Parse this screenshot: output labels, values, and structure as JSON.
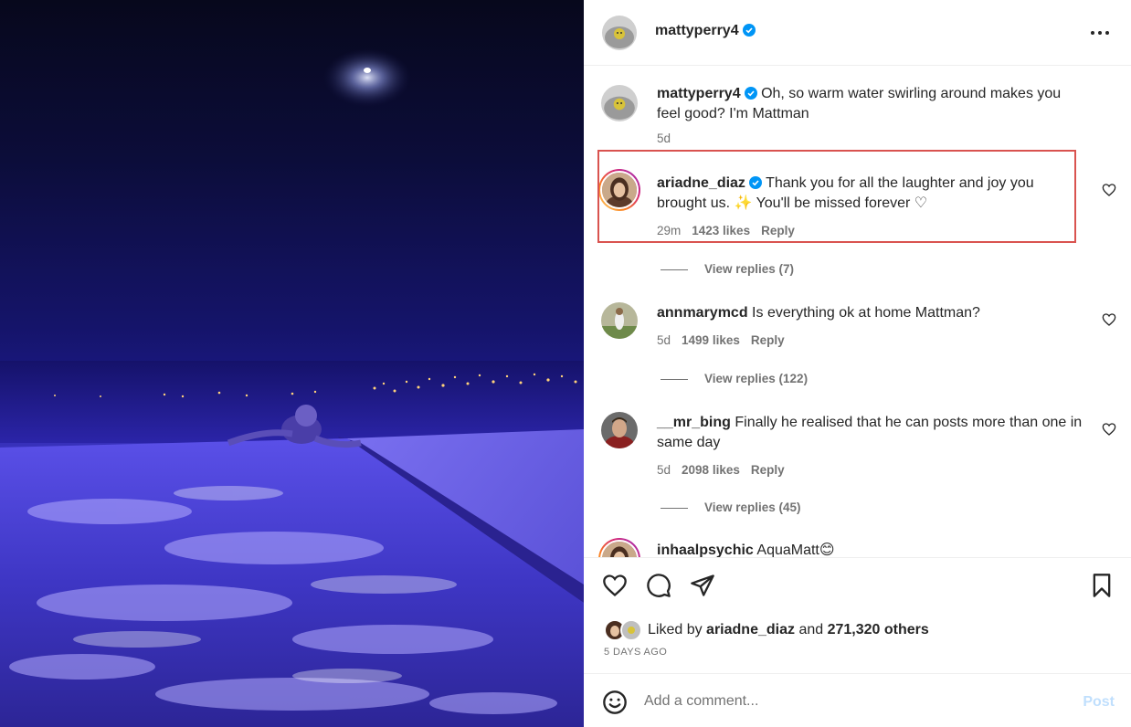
{
  "post": {
    "author": "mattyperry4",
    "image_description_icon": "post-photo"
  },
  "header": {
    "username": "mattyperry4",
    "more_icon": "ellipsis-icon"
  },
  "caption": {
    "username": "mattyperry4",
    "text": "Oh, so warm water swirling around makes you feel good? I'm Mattman",
    "time": "5d"
  },
  "comments": [
    {
      "username": "ariadne_diaz",
      "verified": true,
      "text": "Thank you for all the laughter and joy you brought us. ✨ You'll be missed forever ♡",
      "time": "29m",
      "likes": "1423 likes",
      "reply": "Reply",
      "view_replies": "View replies (7)"
    },
    {
      "username": "annmarymcd",
      "verified": false,
      "text": "Is everything ok at home Mattman?",
      "time": "5d",
      "likes": "1499 likes",
      "reply": "Reply",
      "view_replies": "View replies (122)"
    },
    {
      "username": "__mr_bing",
      "verified": false,
      "text": "Finally he realised that he can posts more than one in same day",
      "time": "5d",
      "likes": "2098 likes",
      "reply": "Reply",
      "view_replies": "View replies (45)"
    },
    {
      "username": "inhaalpsychic",
      "verified": false,
      "text": "AquaMatt😊"
    }
  ],
  "actions": {
    "like_icon": "heart-icon",
    "comment_icon": "comment-icon",
    "share_icon": "share-icon",
    "save_icon": "bookmark-icon",
    "liked_prefix": "Liked by",
    "liked_user": "ariadne_diaz",
    "liked_and": "and",
    "liked_others": "271,320 others",
    "date": "5 DAYS AGO"
  },
  "add_comment": {
    "placeholder": "Add a comment...",
    "post_label": "Post"
  },
  "colors": {
    "highlight_border": "#d9534f",
    "verified_blue": "#0095f6",
    "post_disabled": "#c0dffd"
  }
}
